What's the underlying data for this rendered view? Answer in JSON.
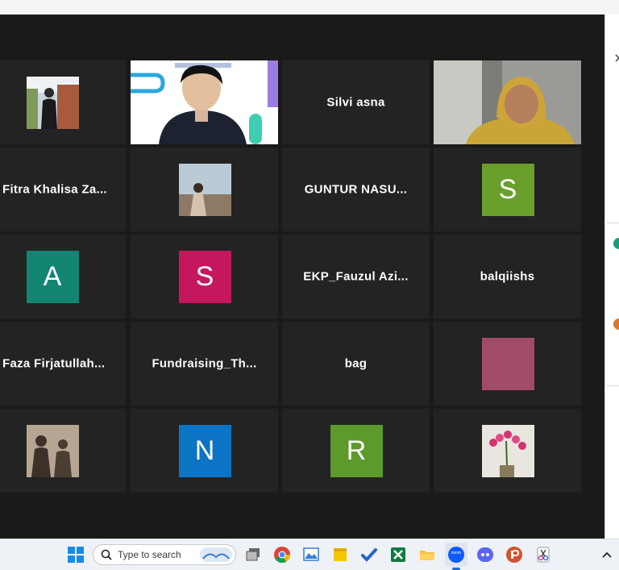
{
  "participants": [
    {
      "name": "",
      "kind": "photo",
      "photo": "man-standing-photo"
    },
    {
      "name": "",
      "kind": "video",
      "photo": "presenter-video"
    },
    {
      "name": "Silvi asna",
      "kind": "name"
    },
    {
      "name": "",
      "kind": "video",
      "photo": "hijab-woman-video"
    },
    {
      "name": "Fitra  Khalisa  Za...",
      "kind": "name"
    },
    {
      "name": "",
      "kind": "photo",
      "photo": "beach-photo"
    },
    {
      "name": "GUNTUR  NASU...",
      "kind": "name"
    },
    {
      "name": "S",
      "kind": "letter",
      "color": "#6a9f2c"
    },
    {
      "name": "A",
      "kind": "letter",
      "color": "#128573"
    },
    {
      "name": "S",
      "kind": "letter",
      "color": "#c5175e"
    },
    {
      "name": "EKP_Fauzul  Azi...",
      "kind": "name"
    },
    {
      "name": "balqiishs",
      "kind": "name"
    },
    {
      "name": "Faza  Firjatullah...",
      "kind": "name"
    },
    {
      "name": "Fundraising_Th...",
      "kind": "name"
    },
    {
      "name": "bag",
      "kind": "name"
    },
    {
      "name": "",
      "kind": "swatch",
      "color": "#a14b67"
    },
    {
      "name": "",
      "kind": "photo",
      "photo": "silhouette-photo"
    },
    {
      "name": "N",
      "kind": "letter",
      "color": "#0b74c4"
    },
    {
      "name": "R",
      "kind": "letter",
      "color": "#5c9a2c"
    },
    {
      "name": "",
      "kind": "photo",
      "photo": "orchid-photo"
    }
  ],
  "taskbar": {
    "search_placeholder": "Type to search",
    "apps": [
      "windows-start-icon",
      "task-view-icon",
      "chrome-icon",
      "photos-icon",
      "sticky-notes-icon",
      "todo-icon",
      "excel-icon",
      "file-explorer-icon",
      "zoom-icon",
      "discord-icon",
      "powerpoint-icon",
      "snipping-tool-icon"
    ],
    "zoom_label": "zoom"
  }
}
